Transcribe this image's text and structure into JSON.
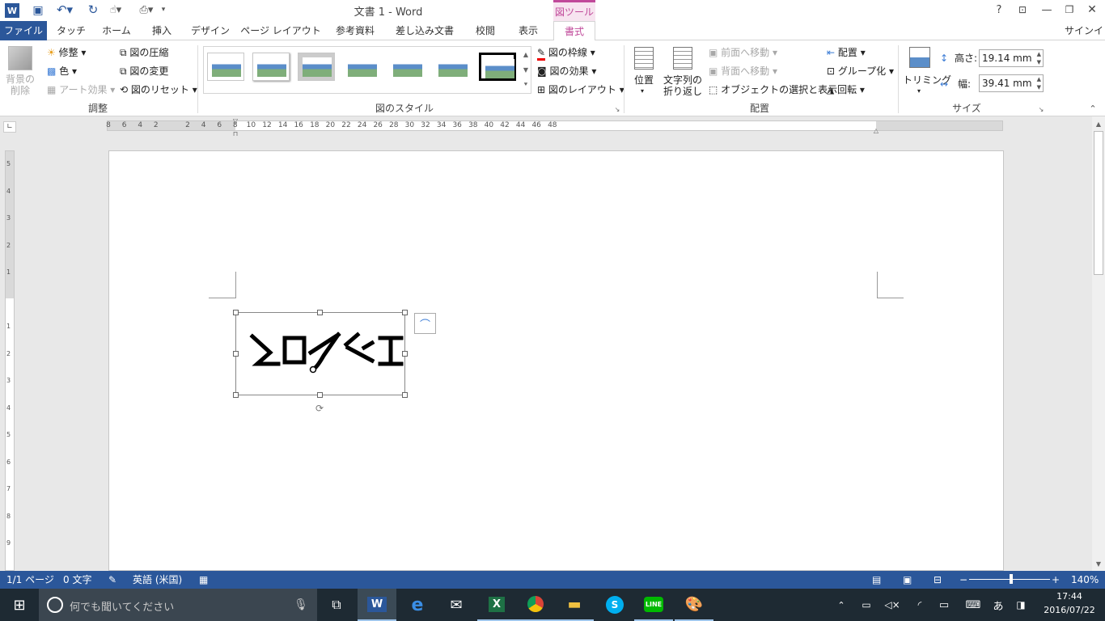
{
  "window": {
    "title": "文書 1 - Word",
    "context_tab": "図ツール",
    "help": "?",
    "signin": "サインイン"
  },
  "tabs": [
    "ファイル",
    "タッチ",
    "ホーム",
    "挿入",
    "デザイン",
    "ページ レイアウト",
    "参考資料",
    "差し込み文書",
    "校閲",
    "表示",
    "書式"
  ],
  "ribbon": {
    "adjust": {
      "remove_bg": "背景の\n削除",
      "corrections": "修整",
      "color": "色",
      "artistic": "アート効果",
      "compress": "図の圧縮",
      "change": "図の変更",
      "reset": "図のリセット",
      "group_label": "調整"
    },
    "styles": {
      "group_label": "図のスタイル",
      "border": "図の枠線",
      "effects": "図の効果",
      "layout": "図のレイアウト"
    },
    "arrange": {
      "position": "位置",
      "wrap_line1": "文字列の",
      "wrap_line2": "折り返し",
      "forward": "前面へ移動",
      "backward": "背面へ移動",
      "selection": "オブジェクトの選択と表示",
      "align": "配置",
      "group": "グループ化",
      "rotate": "回転",
      "group_label": "配置"
    },
    "size": {
      "crop": "トリミング",
      "height_label": "高さ:",
      "height_value": "19.14 mm",
      "width_label": "幅:",
      "width_value": "39.41 mm",
      "group_label": "サイズ"
    }
  },
  "ruler": {
    "h_labels": [
      "8",
      "6",
      "4",
      "2",
      "",
      "2",
      "4",
      "6",
      "8",
      "10",
      "12",
      "14",
      "16",
      "18",
      "20",
      "22",
      "24",
      "26",
      "28",
      "30",
      "32",
      "34",
      "36",
      "38",
      "40",
      "42",
      "44",
      "46",
      "48"
    ]
  },
  "status": {
    "page": "1/1 ページ",
    "words": "0 文字",
    "language": "英語 (米国)",
    "zoom": "140%"
  },
  "taskbar": {
    "search_placeholder": "何でも聞いてください",
    "ime": "あ",
    "time": "17:44",
    "date": "2016/07/22"
  },
  "colors": {
    "word_blue": "#2b579a",
    "context_pink": "#c0499a",
    "taskbar": "#1e2a33"
  }
}
